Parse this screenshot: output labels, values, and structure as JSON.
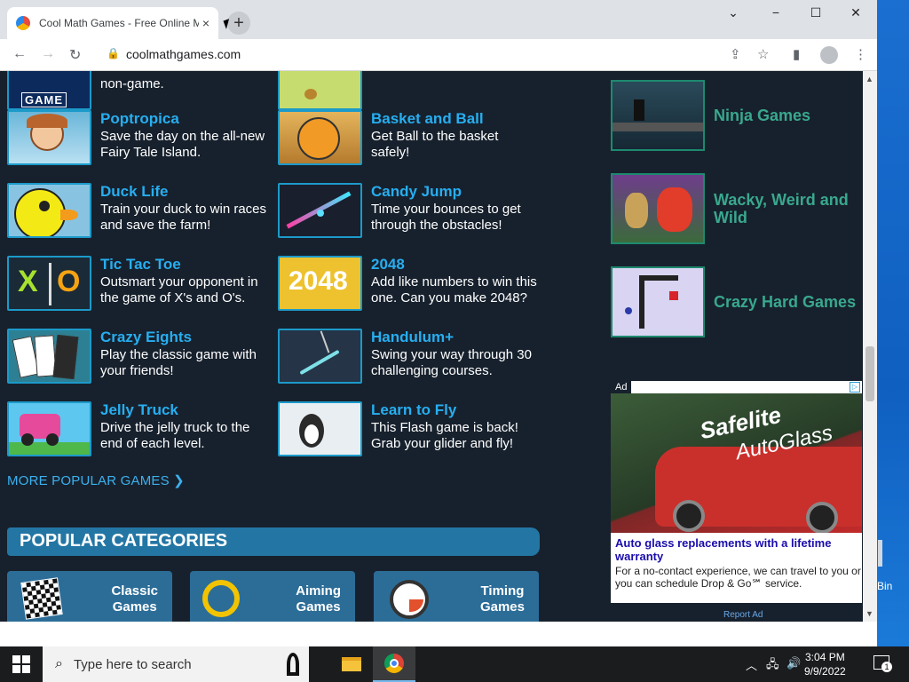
{
  "browser": {
    "tab_title": "Cool Math Games - Free Online M",
    "tab_close": "×",
    "new_tab": "+",
    "url": "coolmathgames.com",
    "controls": {
      "min": "−",
      "max": "☐",
      "close": "✕",
      "menu": "⌄"
    }
  },
  "games_left": [
    {
      "name": "",
      "desc": "non-game."
    },
    {
      "name": "Poptropica",
      "desc": "Save the day on the all-new Fairy Tale Island."
    },
    {
      "name": "Duck Life",
      "desc": "Train your duck to win races and save the farm!"
    },
    {
      "name": "Tic Tac Toe",
      "desc": "Outsmart your opponent in the game of X's and O's."
    },
    {
      "name": "Crazy Eights",
      "desc": "Play the classic game with your friends!"
    },
    {
      "name": "Jelly Truck",
      "desc": "Drive the jelly truck to the end of each level."
    }
  ],
  "games_right": [
    {
      "name": "Basket and Ball",
      "desc": "Get Ball to the basket safely!"
    },
    {
      "name": "Candy Jump",
      "desc": "Time your bounces to get through the obstacles!"
    },
    {
      "name": "2048",
      "desc": "Add like numbers to win this one. Can you make 2048?"
    },
    {
      "name": "Handulum+",
      "desc": "Swing your way through 30 challenging courses."
    },
    {
      "name": "Learn to Fly",
      "desc": "This Flash game is back! Grab your glider and fly!"
    }
  ],
  "thumb_labels": {
    "nogame": "GAME",
    "t2048": "2048",
    "ttt_x": "X",
    "ttt_o": "O"
  },
  "more_link": "MORE POPULAR GAMES ❯",
  "categories": {
    "title": "POPULAR CATEGORIES",
    "items": [
      {
        "line1": "Classic",
        "line2": "Games"
      },
      {
        "line1": "Aiming",
        "line2": "Games"
      },
      {
        "line1": "Timing",
        "line2": "Games"
      }
    ]
  },
  "sidebar": [
    {
      "name": "Ninja Games"
    },
    {
      "name": "Wacky, Weird and Wild"
    },
    {
      "name": "Crazy Hard Games"
    }
  ],
  "ad": {
    "tag": "Ad",
    "brand1": "Safelite",
    "brand2": "AutoGlass",
    "headline": "Auto glass replacements with a lifetime warranty",
    "body": "For a no-contact experience, we can travel to you or you can schedule Drop & Go℠ service.",
    "report": "Report Ad"
  },
  "desktop": {
    "bin_label": "Bin"
  },
  "taskbar": {
    "search_placeholder": "Type here to search",
    "time": "3:04 PM",
    "date": "9/9/2022",
    "notifications": "1"
  }
}
